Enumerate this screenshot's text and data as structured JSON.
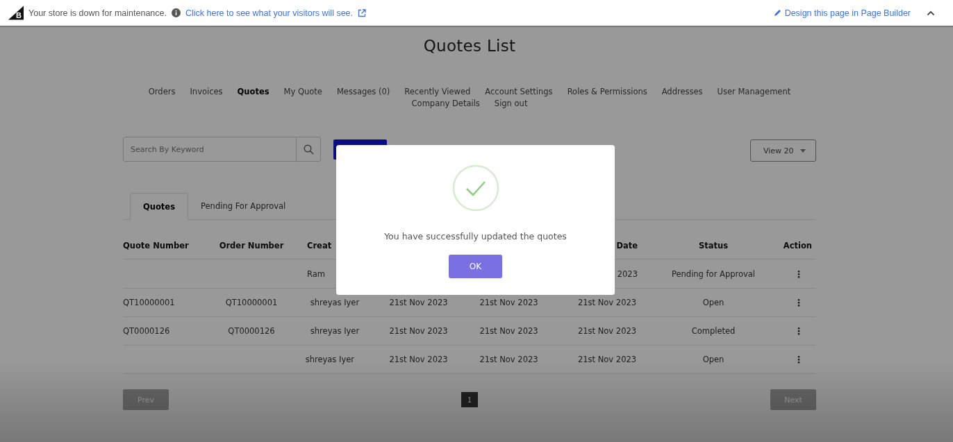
{
  "topbar": {
    "logo": "B",
    "message": "Your store is down for maintenance.",
    "preview_link": "Click here to see what your visitors will see.",
    "builder_link": "Design this page in Page Builder"
  },
  "title": "Quotes List",
  "nav": [
    {
      "label": "Orders",
      "selected": false
    },
    {
      "label": "Invoices",
      "selected": false
    },
    {
      "label": "Quotes",
      "selected": true
    },
    {
      "label": "My Quote",
      "selected": false
    },
    {
      "label": "Messages (0)",
      "selected": false
    },
    {
      "label": "Recently Viewed",
      "selected": false
    },
    {
      "label": "Account Settings",
      "selected": false
    },
    {
      "label": "Roles & Permissions",
      "selected": false
    },
    {
      "label": "Addresses",
      "selected": false
    },
    {
      "label": "User Management",
      "selected": false
    },
    {
      "label": "Company Details",
      "selected": false
    },
    {
      "label": "Sign out",
      "selected": false
    }
  ],
  "search": {
    "placeholder": "Search By Keyword"
  },
  "view_select": {
    "value": "View 20"
  },
  "tabs": [
    {
      "label": "Quotes",
      "selected": true
    },
    {
      "label": "Pending For Approval",
      "selected": false
    }
  ],
  "table": {
    "header": {
      "quote_number": "Quote Number",
      "order_number": "Order Number",
      "column_3": "Creat",
      "column_6": "Date",
      "status": "Status",
      "action": "Action"
    },
    "rows": [
      {
        "column_3": "Ram",
        "column_6": "2023",
        "status": "Pending for Approval",
        "action": "⋮"
      },
      {
        "quote_number": "QT10000001",
        "order_number": "QT10000001",
        "column_3": "shreyas Iyer",
        "column_4": "21st Nov 2023",
        "column_5": "21st Nov 2023",
        "column_6": "21st Nov 2023",
        "status": "Open",
        "action": "⋮"
      },
      {
        "quote_number": "QT0000126",
        "order_number": "QT0000126",
        "column_3": "shreyas Iyer",
        "column_4": "21st Nov 2023",
        "column_5": "21st Nov 2023",
        "column_6": "21st Nov 2023",
        "status": "Completed",
        "action": "⋮"
      },
      {
        "column_3": "shreyas Iyer",
        "column_4": "21st Nov 2023",
        "column_5": "21st Nov 2023",
        "column_6": "21st Nov 2023",
        "status": "Open",
        "action": "⋮"
      }
    ]
  },
  "pagination": {
    "prev": "Prev",
    "pages": [
      {
        "label": "1",
        "selected": true
      }
    ],
    "next": "Next"
  },
  "modal": {
    "message": "You have successfully updated the quotes",
    "button": "OK"
  }
}
